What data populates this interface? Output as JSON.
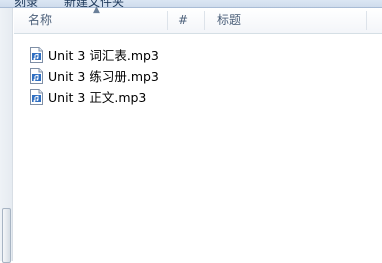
{
  "toolbar": {
    "btn1_label": "刻录",
    "btn2_label": "新建文件夹"
  },
  "columns": {
    "name": "名称",
    "number": "#",
    "title": "标题"
  },
  "files": [
    {
      "name": "Unit 3 词汇表.mp3",
      "icon": "audio-file-icon"
    },
    {
      "name": "Unit 3 练习册.mp3",
      "icon": "audio-file-icon"
    },
    {
      "name": "Unit 3 正文.mp3",
      "icon": "audio-file-icon"
    }
  ],
  "colors": {
    "header_text": "#4c607a",
    "file_text": "#000000",
    "icon_blue": "#2f6fc2"
  }
}
